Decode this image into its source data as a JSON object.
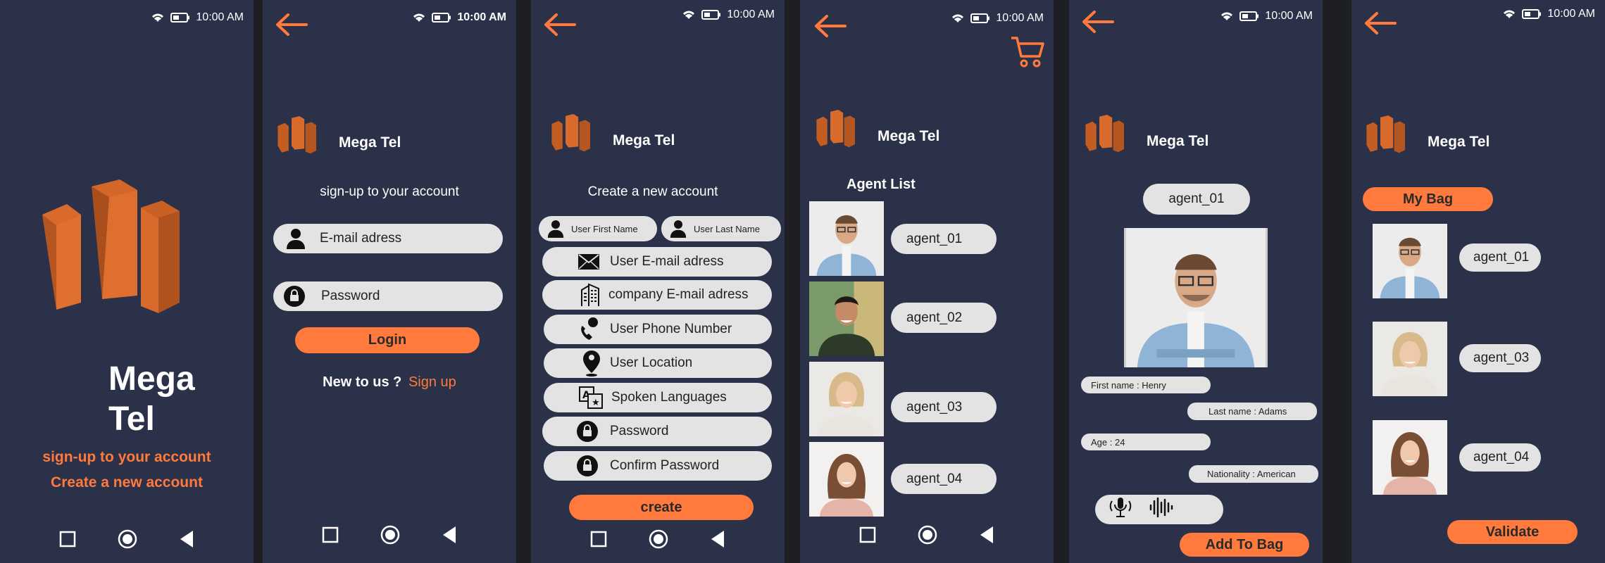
{
  "status": {
    "time": "10:00 AM"
  },
  "brand": {
    "name": "Mega Tel",
    "line1": "Mega",
    "line2": "Tel"
  },
  "colors": {
    "background": "#2a3148",
    "accent": "#ff7a3c",
    "pill": "#e3e3e3"
  },
  "splash": {
    "link_signup": "sign-up to your account",
    "link_create": "Create a new account"
  },
  "login": {
    "heading": "sign-up to your account",
    "email_placeholder": "E-mail adress",
    "password_placeholder": "Password",
    "login_label": "Login",
    "new_prefix": "New to us ?",
    "signup_link": "Sign up"
  },
  "register": {
    "heading": "Create a new account",
    "first_name": "User First Name",
    "last_name": "User Last Name",
    "email": "User E-mail adress",
    "company_email": "company E-mail adress",
    "phone": "User Phone Number",
    "location": "User Location",
    "languages": "Spoken Languages",
    "password": "Password",
    "confirm_password": "Confirm Password",
    "create_label": "create"
  },
  "agent_list": {
    "title": "Agent List",
    "agents": [
      "agent_01",
      "agent_02",
      "agent_03",
      "agent_04"
    ]
  },
  "agent_detail": {
    "name": "agent_01",
    "first_name": "First name : Henry",
    "last_name": "Last name  : Adams",
    "age": "Age : 24",
    "nationality": "Nationality : American",
    "add_label": "Add To Bag"
  },
  "bag": {
    "title": "My Bag",
    "agents": [
      "agent_01",
      "agent_03",
      "agent_04"
    ],
    "validate_label": "Validate"
  }
}
